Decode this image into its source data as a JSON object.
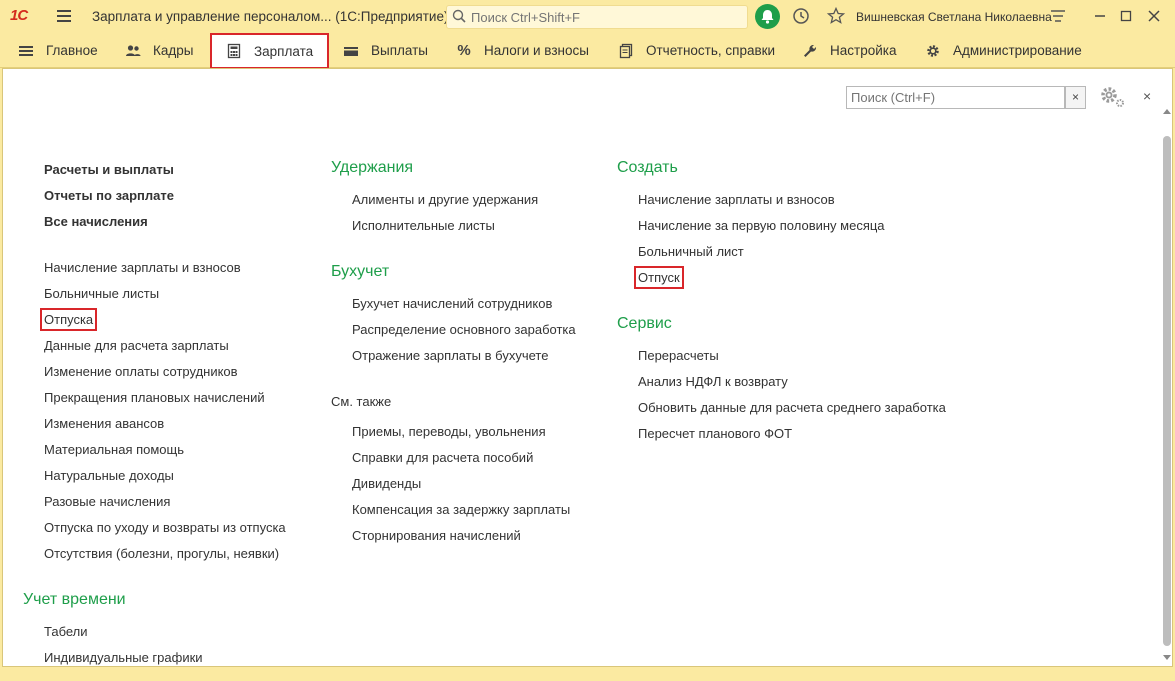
{
  "titlebar": {
    "logo": "1С",
    "app_title": "Зарплата и управление персоналом...  (1С:Предприятие)",
    "search_placeholder": "Поиск Ctrl+Shift+F",
    "user_name": "Вишневская Светлана Николаевна"
  },
  "menu": {
    "items": [
      {
        "label": "Главное",
        "icon": "hamburger-icon"
      },
      {
        "label": "Кадры",
        "icon": "people-icon"
      },
      {
        "label": "Зарплата",
        "icon": "calculator-icon",
        "active": true
      },
      {
        "label": "Выплаты",
        "icon": "wallet-icon"
      },
      {
        "label": "Налоги и взносы",
        "icon": "percent-icon"
      },
      {
        "label": "Отчетность, справки",
        "icon": "documents-icon"
      },
      {
        "label": "Настройка",
        "icon": "wrench-icon"
      },
      {
        "label": "Администрирование",
        "icon": "gear-icon"
      }
    ]
  },
  "panel": {
    "search_placeholder": "Поиск (Ctrl+F)",
    "clear_label": "×",
    "close_label": "×"
  },
  "col1": {
    "bold_items": [
      "Расчеты и выплаты",
      "Отчеты по зарплате",
      "Все начисления"
    ],
    "items": [
      "Начисление зарплаты и взносов",
      "Больничные листы",
      "Отпуска",
      "Данные для расчета зарплаты",
      "Изменение оплаты сотрудников",
      "Прекращения плановых начислений",
      "Изменения авансов",
      "Материальная помощь",
      "Натуральные доходы",
      "Разовые начисления",
      "Отпуска по уходу и возвраты из отпуска",
      "Отсутствия (болезни, прогулы, неявки)"
    ],
    "time_group": "Учет времени",
    "time_items": [
      "Табели",
      "Индивидуальные графики"
    ]
  },
  "col2": {
    "group1": "Удержания",
    "group1_items": [
      "Алименты и другие удержания",
      "Исполнительные листы"
    ],
    "group2": "Бухучет",
    "group2_items": [
      "Бухучет начислений сотрудников",
      "Распределение основного заработка",
      "Отражение зарплаты в бухучете"
    ],
    "see_also": "См. также",
    "see_also_items": [
      "Приемы, переводы, увольнения",
      "Справки для расчета пособий",
      "Дивиденды",
      "Компенсация за задержку зарплаты",
      "Сторнирования начислений"
    ]
  },
  "col3": {
    "group1": "Создать",
    "group1_items": [
      "Начисление зарплаты и взносов",
      "Начисление за первую половину месяца",
      "Больничный лист",
      "Отпуск"
    ],
    "group2": "Сервис",
    "group2_items": [
      "Перерасчеты",
      "Анализ НДФЛ к возврату",
      "Обновить данные для расчета среднего заработка",
      "Пересчет планового ФОТ"
    ]
  },
  "colors": {
    "accent_green": "#1e9e4a",
    "highlight_red": "#d9262a",
    "bar_yellow": "#fbeaa1"
  }
}
